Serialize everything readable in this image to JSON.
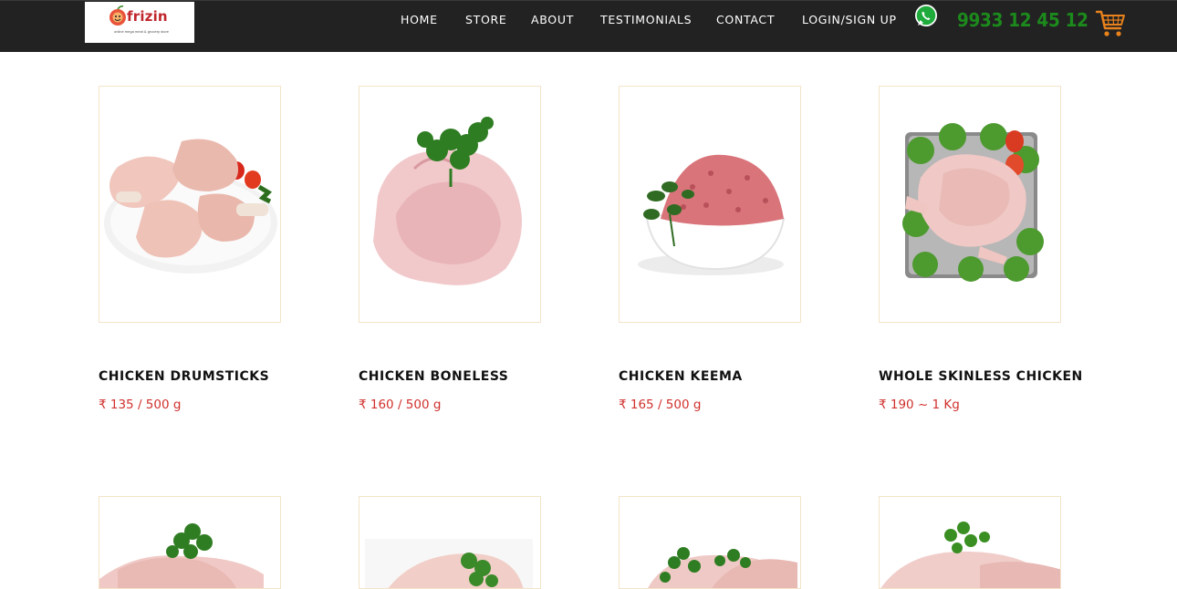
{
  "header": {
    "logo_text": "frizin",
    "logo_tagline": "online mega meat & grocery store",
    "nav": [
      "HOME",
      "STORE",
      "ABOUT",
      "TESTIMONIALS",
      "CONTACT",
      "LOGIN/SIGN UP"
    ],
    "phone": "9933 12 45 12",
    "whatsapp_icon": "whatsapp-icon",
    "cart_icon": "shopping-cart-icon"
  },
  "products": [
    {
      "name": "CHICKEN DRUMSTICKS",
      "price": "₹ 135 / 500 g"
    },
    {
      "name": "CHICKEN BONELESS",
      "price": "₹ 160 / 500 g"
    },
    {
      "name": "CHICKEN KEEMA",
      "price": "₹ 165 / 500 g"
    },
    {
      "name": "WHOLE SKINLESS CHICKEN",
      "price": "₹ 190 ~ 1 Kg"
    }
  ],
  "colors": {
    "header_bg": "#222222",
    "phone": "#1c8a1c",
    "price": "#d0312d",
    "cart": "#e8821c",
    "card_border": "#f3e4c8"
  }
}
